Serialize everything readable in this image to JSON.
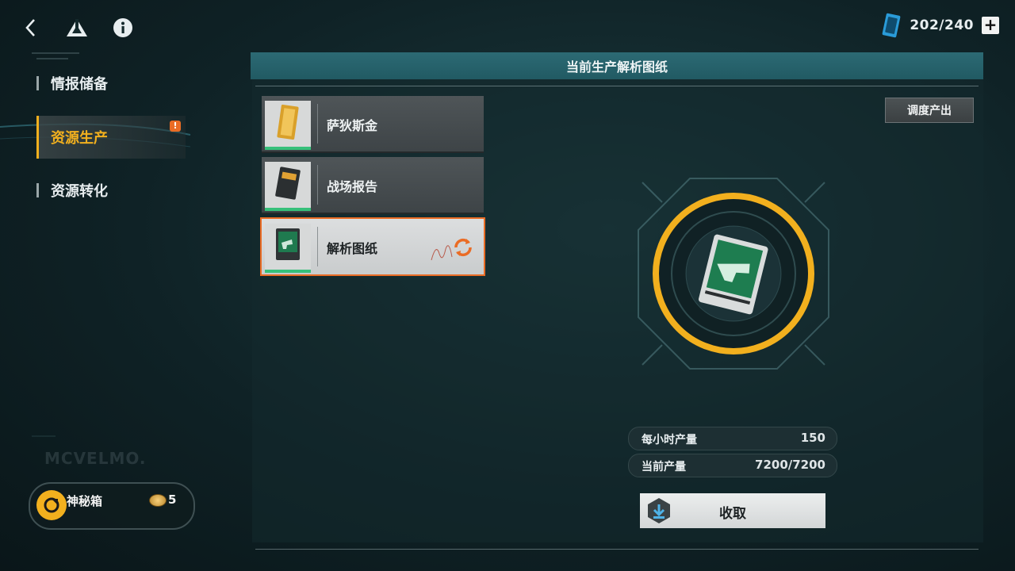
{
  "topbar": {
    "back_icon": "chevron-left-icon",
    "logo_icon": "triangle-logo-icon",
    "info_icon": "info-icon",
    "currency_icon": "data-card-icon",
    "currency_count": "202/240",
    "add_label": "+"
  },
  "sidebar": {
    "items": [
      {
        "label": "情报储备",
        "active": false
      },
      {
        "label": "资源生产",
        "active": true,
        "alert": "!"
      },
      {
        "label": "资源转化",
        "active": false
      }
    ],
    "watermark": "MCVELMO.",
    "mystery_box": {
      "label": "神秘箱",
      "count": "5"
    }
  },
  "panel": {
    "title": "当前生产解析图纸",
    "dispatch_label": "调度产出",
    "resources": [
      {
        "name": "萨狄斯金",
        "selected": false
      },
      {
        "name": "战场报告",
        "selected": false
      },
      {
        "name": "解析图纸",
        "selected": true
      }
    ],
    "stats": [
      {
        "label": "每小时产量",
        "value": "150"
      },
      {
        "label": "当前产量",
        "value": "7200/7200"
      }
    ],
    "collect_label": "收取"
  },
  "colors": {
    "accent": "#f2b01e",
    "alert": "#ea6c25",
    "header": "#2c6a74",
    "progress_green": "#36c07a"
  }
}
